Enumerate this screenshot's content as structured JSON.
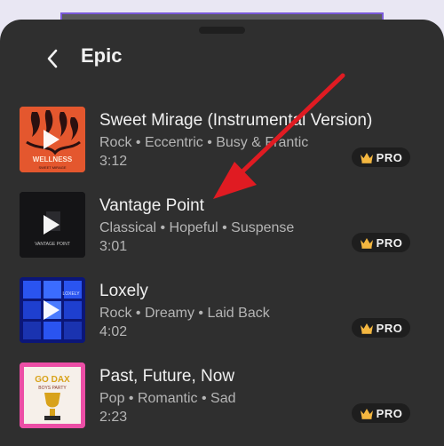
{
  "header": {
    "title": "Epic"
  },
  "colors": {
    "panel_bg": "#2f2f2f",
    "badge_bg": "#1e1e1e",
    "crown": "#f4b740",
    "arrow": "#e01b22"
  },
  "tracks": [
    {
      "title": "Sweet Mirage (Instrumental Version)",
      "meta": "Rock • Eccentric • Busy & Frantic",
      "duration": "3:12",
      "badge": "PRO",
      "art_text": "WELLNESS",
      "art_sub": "SWEET MIRAGE"
    },
    {
      "title": "Vantage Point",
      "meta": "Classical • Hopeful • Suspense",
      "duration": "3:01",
      "badge": "PRO",
      "art_text": "VANTAGE POINT"
    },
    {
      "title": "Loxely",
      "meta": "Rock • Dreamy • Laid Back",
      "duration": "4:02",
      "badge": "PRO",
      "art_text": "LOXELY"
    },
    {
      "title": "Past, Future, Now",
      "meta": "Pop • Romantic • Sad",
      "duration": "2:23",
      "badge": "PRO",
      "art_text": "GO DAX",
      "art_sub": "BOYS PARTY"
    }
  ]
}
